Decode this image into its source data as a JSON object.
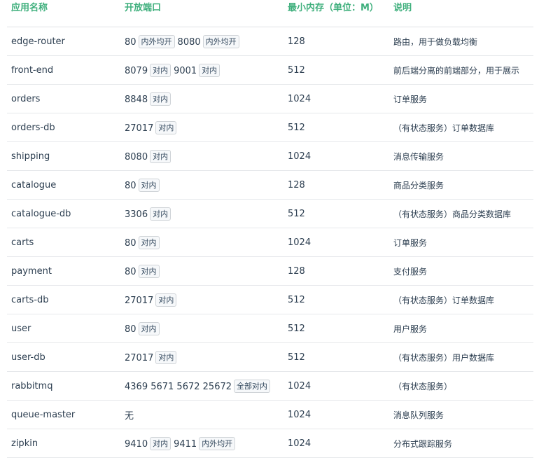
{
  "headers": {
    "name": "应用名称",
    "ports": "开放端口",
    "memory": "最小内存（单位：M）",
    "desc": "说明"
  },
  "rows": [
    {
      "name": "edge-router",
      "ports": [
        {
          "num": "80",
          "tag": "内外均开"
        },
        {
          "num": "8080",
          "tag": "内外均开"
        }
      ],
      "memory": "128",
      "desc": "路由，用于做负载均衡"
    },
    {
      "name": "front-end",
      "ports": [
        {
          "num": "8079",
          "tag": "对内"
        },
        {
          "num": "9001",
          "tag": "对内"
        }
      ],
      "memory": "512",
      "desc": "前后端分离的前端部分，用于展示"
    },
    {
      "name": "orders",
      "ports": [
        {
          "num": "8848",
          "tag": "对内"
        }
      ],
      "memory": "1024",
      "desc": "订单服务"
    },
    {
      "name": "orders-db",
      "ports": [
        {
          "num": "27017",
          "tag": "对内"
        }
      ],
      "memory": "512",
      "desc": "（有状态服务）订单数据库"
    },
    {
      "name": "shipping",
      "ports": [
        {
          "num": "8080",
          "tag": "对内"
        }
      ],
      "memory": "1024",
      "desc": "消息传输服务"
    },
    {
      "name": "catalogue",
      "ports": [
        {
          "num": "80",
          "tag": "对内"
        }
      ],
      "memory": "128",
      "desc": "商品分类服务"
    },
    {
      "name": "catalogue-db",
      "ports": [
        {
          "num": "3306",
          "tag": "对内"
        }
      ],
      "memory": "512",
      "desc": "（有状态服务）商品分类数据库"
    },
    {
      "name": "carts",
      "ports": [
        {
          "num": "80",
          "tag": "对内"
        }
      ],
      "memory": "1024",
      "desc": "订单服务"
    },
    {
      "name": "payment",
      "ports": [
        {
          "num": "80",
          "tag": "对内"
        }
      ],
      "memory": "128",
      "desc": "支付服务"
    },
    {
      "name": "carts-db",
      "ports": [
        {
          "num": "27017",
          "tag": "对内"
        }
      ],
      "memory": "512",
      "desc": "（有状态服务）订单数据库"
    },
    {
      "name": "user",
      "ports": [
        {
          "num": "80",
          "tag": "对内"
        }
      ],
      "memory": "512",
      "desc": "用户服务"
    },
    {
      "name": "user-db",
      "ports": [
        {
          "num": "27017",
          "tag": "对内"
        }
      ],
      "memory": "512",
      "desc": "（有状态服务）用户数据库"
    },
    {
      "name": "rabbitmq",
      "ports": [
        {
          "num": "4369 5671  5672 25672",
          "tag": "全部对内"
        }
      ],
      "memory": "1024",
      "desc": "（有状态服务）"
    },
    {
      "name": "queue-master",
      "ports": [
        {
          "num": "无",
          "tag": ""
        }
      ],
      "memory": "1024",
      "desc": "消息队列服务"
    },
    {
      "name": "zipkin",
      "ports": [
        {
          "num": "9410",
          "tag": "对内"
        },
        {
          "num": "9411",
          "tag": "内外均开"
        }
      ],
      "memory": "1024",
      "desc": "分布式跟踪服务"
    }
  ]
}
